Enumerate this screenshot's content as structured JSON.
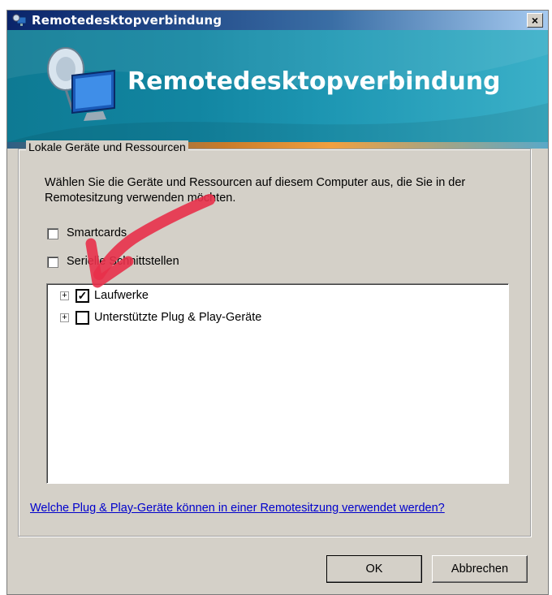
{
  "window": {
    "title": "Remotedesktopverbindung",
    "close_label": "×"
  },
  "banner": {
    "title": "Remotedesktopverbindung"
  },
  "group": {
    "label": "Lokale Geräte und Ressourcen",
    "description": "Wählen Sie die Geräte und Ressourcen auf diesem Computer aus, die Sie in der Remotesitzung verwenden möchten."
  },
  "checkboxes": [
    {
      "label": "Smartcards",
      "checked": false
    },
    {
      "label": "Serielle Schnittstellen",
      "checked": false
    }
  ],
  "tree": {
    "items": [
      {
        "label": "Laufwerke",
        "checked": true,
        "expander": "+",
        "check_mark": "✓"
      },
      {
        "label": "Unterstützte Plug & Play-Geräte",
        "checked": false,
        "expander": "+",
        "check_mark": ""
      }
    ]
  },
  "help_link": "Welche Plug & Play-Geräte können in einer Remotesitzung verwendet werden?",
  "buttons": {
    "ok": "OK",
    "cancel": "Abbrechen"
  },
  "colors": {
    "dialog_bg": "#d4d0c8",
    "banner": "#1286a2",
    "link": "#0000cc",
    "annotation_arrow": "#e8304a"
  },
  "icons": {
    "title": "remote-desktop-icon",
    "banner": "remote-desktop-monitor-icon",
    "expander": "plus-box-icon"
  }
}
